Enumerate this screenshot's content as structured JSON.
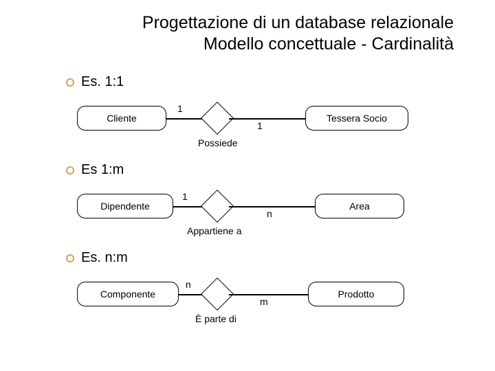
{
  "title_line1": "Progettazione di un database relazionale",
  "title_line2": "Modello concettuale - Cardinalità",
  "sections": {
    "s1": {
      "heading": "Es. 1:1",
      "left": "Cliente",
      "right": "Tessera Socio",
      "rel": "Possiede",
      "lcard": "1",
      "rcard": "1"
    },
    "s2": {
      "heading": "Es 1:m",
      "left": "Dipendente",
      "right": "Area",
      "rel": "Appartiene a",
      "lcard": "1",
      "rcard": "n"
    },
    "s3": {
      "heading": "Es. n:m",
      "left": "Componente",
      "right": "Prodotto",
      "rel": "È parte di",
      "lcard": "n",
      "rcard": "m"
    }
  }
}
